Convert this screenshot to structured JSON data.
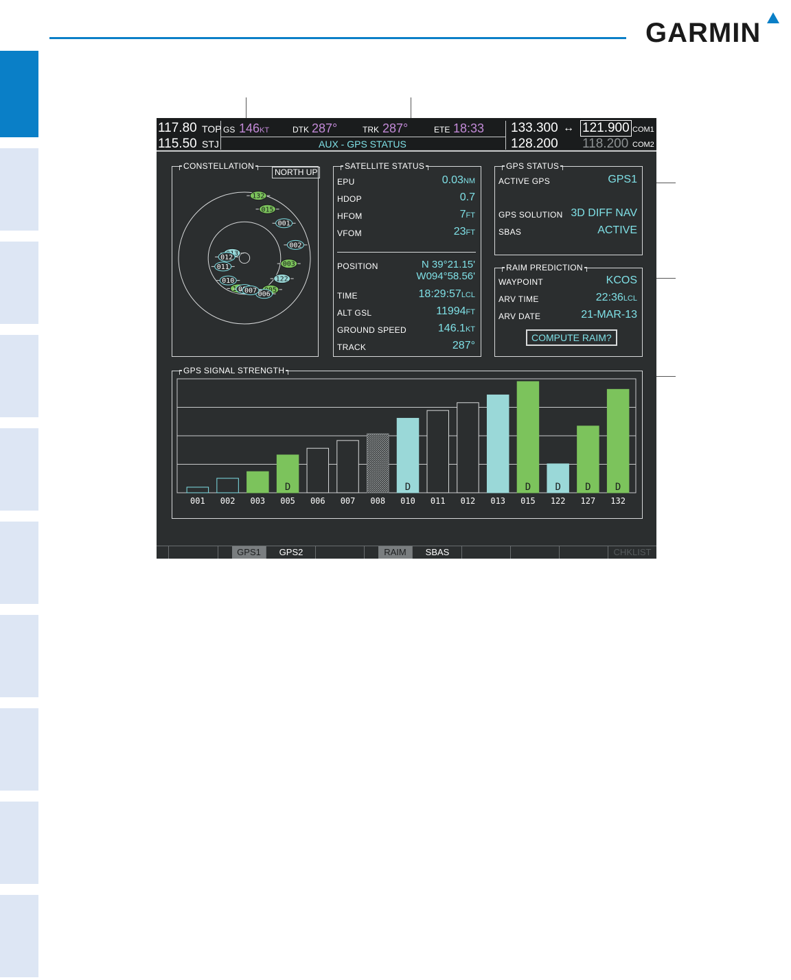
{
  "brand": "GARMIN",
  "header": {
    "nav_freq_active": "117.80",
    "nav_freq_standby": "115.50",
    "nav_id_1": "TOP",
    "nav_id_2": "STJ",
    "gs_label": "GS",
    "gs_value": "146",
    "gs_unit": "KT",
    "dtk_label": "DTK",
    "dtk_value": "287°",
    "trk_label": "TRK",
    "trk_value": "287°",
    "ete_label": "ETE",
    "ete_value": "18:33",
    "page_title": "AUX - GPS STATUS",
    "com1_active": "133.300",
    "com1_swap": "↔",
    "com1_standby": "121.900",
    "com1_label": "COM1",
    "com2_active": "128.200",
    "com2_standby": "118.200",
    "com2_label": "COM2"
  },
  "constellation": {
    "title": "CONSTELLATION",
    "orientation_button": "NORTH UP",
    "satellites": [
      {
        "id": "001",
        "ax": 0.135,
        "dist": 0.8,
        "state": "empty"
      },
      {
        "id": "002",
        "ax": 0.21,
        "dist": 0.8,
        "state": "empty"
      },
      {
        "id": "015",
        "ax": 0.07,
        "dist": 0.82,
        "state": "green"
      },
      {
        "id": "132",
        "ax": 0.035,
        "dist": 0.97,
        "state": "green"
      },
      {
        "id": "003",
        "ax": 0.27,
        "dist": 0.68,
        "state": "green"
      },
      {
        "id": "122",
        "ax": 0.33,
        "dist": 0.65,
        "state": "cyan"
      },
      {
        "id": "013",
        "ax": 0.81,
        "dist": 0.2,
        "state": "cyan"
      },
      {
        "id": "012",
        "ax": 0.76,
        "dist": 0.27,
        "state": "empty"
      },
      {
        "id": "011",
        "ax": 0.69,
        "dist": 0.35,
        "state": "empty"
      },
      {
        "id": "005",
        "ax": 0.39,
        "dist": 0.62,
        "state": "green"
      },
      {
        "id": "010",
        "ax": 0.6,
        "dist": 0.42,
        "state": "empty"
      },
      {
        "id": "006",
        "ax": 0.42,
        "dist": 0.62,
        "state": "empty"
      },
      {
        "id": "127",
        "ax": 0.53,
        "dist": 0.47,
        "state": "green"
      },
      {
        "id": "008",
        "ax": 0.5,
        "dist": 0.47,
        "state": "empty"
      },
      {
        "id": "007",
        "ax": 0.47,
        "dist": 0.5,
        "state": "empty"
      }
    ]
  },
  "satellite_status": {
    "title": "SATELLITE STATUS",
    "rows": [
      {
        "label": "EPU",
        "value": "0.03",
        "unit": "NM"
      },
      {
        "label": "HDOP",
        "value": "0.7",
        "unit": ""
      },
      {
        "label": "HFOM",
        "value": "7",
        "unit": "FT"
      },
      {
        "label": "VFOM",
        "value": "23",
        "unit": "FT"
      }
    ],
    "position_label": "POSITION",
    "position_lat": "N 39°21.15'",
    "position_lon": "W094°58.56'",
    "rows2": [
      {
        "label": "TIME",
        "value": "18:29:57",
        "unit": "LCL"
      },
      {
        "label": "ALT GSL",
        "value": "11994",
        "unit": "FT"
      },
      {
        "label": "GROUND SPEED",
        "value": "146.1",
        "unit": "KT"
      },
      {
        "label": "TRACK",
        "value": "287°",
        "unit": ""
      }
    ]
  },
  "gps_status": {
    "title": "GPS STATUS",
    "active_gps_label": "ACTIVE GPS",
    "active_gps_value": "GPS1",
    "solution_label": "GPS SOLUTION",
    "solution_value": "3D DIFF NAV",
    "sbas_label": "SBAS",
    "sbas_value": "ACTIVE"
  },
  "raim": {
    "title": "RAIM PREDICTION",
    "waypoint_label": "WAYPOINT",
    "waypoint_value": "KCOS",
    "arv_time_label": "ARV TIME",
    "arv_time_value": "22:36",
    "arv_time_unit": "LCL",
    "arv_date_label": "ARV DATE",
    "arv_date_value": "21-MAR-13",
    "compute_button": "COMPUTE RAIM?"
  },
  "signal": {
    "title": "GPS SIGNAL STRENGTH",
    "bars": [
      {
        "id": "001",
        "level": 0.05,
        "state": "empty",
        "diff": false
      },
      {
        "id": "002",
        "level": 0.13,
        "state": "empty",
        "diff": false
      },
      {
        "id": "003",
        "level": 0.19,
        "state": "green",
        "diff": false
      },
      {
        "id": "005",
        "level": 0.34,
        "state": "green",
        "diff": true
      },
      {
        "id": "006",
        "level": 0.4,
        "state": "empty",
        "diff": false
      },
      {
        "id": "007",
        "level": 0.47,
        "state": "empty",
        "diff": false
      },
      {
        "id": "008",
        "level": 0.53,
        "state": "hatched",
        "diff": false
      },
      {
        "id": "010",
        "level": 0.67,
        "state": "cyan",
        "diff": true
      },
      {
        "id": "011",
        "level": 0.74,
        "state": "empty",
        "diff": false
      },
      {
        "id": "012",
        "level": 0.81,
        "state": "empty",
        "diff": false
      },
      {
        "id": "013",
        "level": 0.88,
        "state": "cyan",
        "diff": false
      },
      {
        "id": "015",
        "level": 1.0,
        "state": "green",
        "diff": true
      },
      {
        "id": "122",
        "level": 0.26,
        "state": "cyan",
        "diff": true
      },
      {
        "id": "127",
        "level": 0.6,
        "state": "green",
        "diff": true
      },
      {
        "id": "132",
        "level": 0.93,
        "state": "green",
        "diff": true
      }
    ],
    "diff_marker": "D"
  },
  "softkeys": [
    {
      "label": "",
      "state": "normal"
    },
    {
      "label": "",
      "state": "normal"
    },
    {
      "label": "GPS1",
      "state": "on"
    },
    {
      "label": "GPS2",
      "state": "normal"
    },
    {
      "label": "",
      "state": "normal"
    },
    {
      "label": "RAIM",
      "state": "on"
    },
    {
      "label": "SBAS",
      "state": "normal"
    },
    {
      "label": "",
      "state": "normal"
    },
    {
      "label": "",
      "state": "normal"
    },
    {
      "label": "",
      "state": "normal"
    },
    {
      "label": "CHKLIST",
      "state": "dim"
    }
  ],
  "colors": {
    "accent": "#0a7fc7",
    "tab_dark": "#0a7fc7",
    "tab_light": "#dde6f4",
    "green": "#7cc35c",
    "cyan": "#9ad8d8",
    "magenta": "#c38ad8"
  }
}
